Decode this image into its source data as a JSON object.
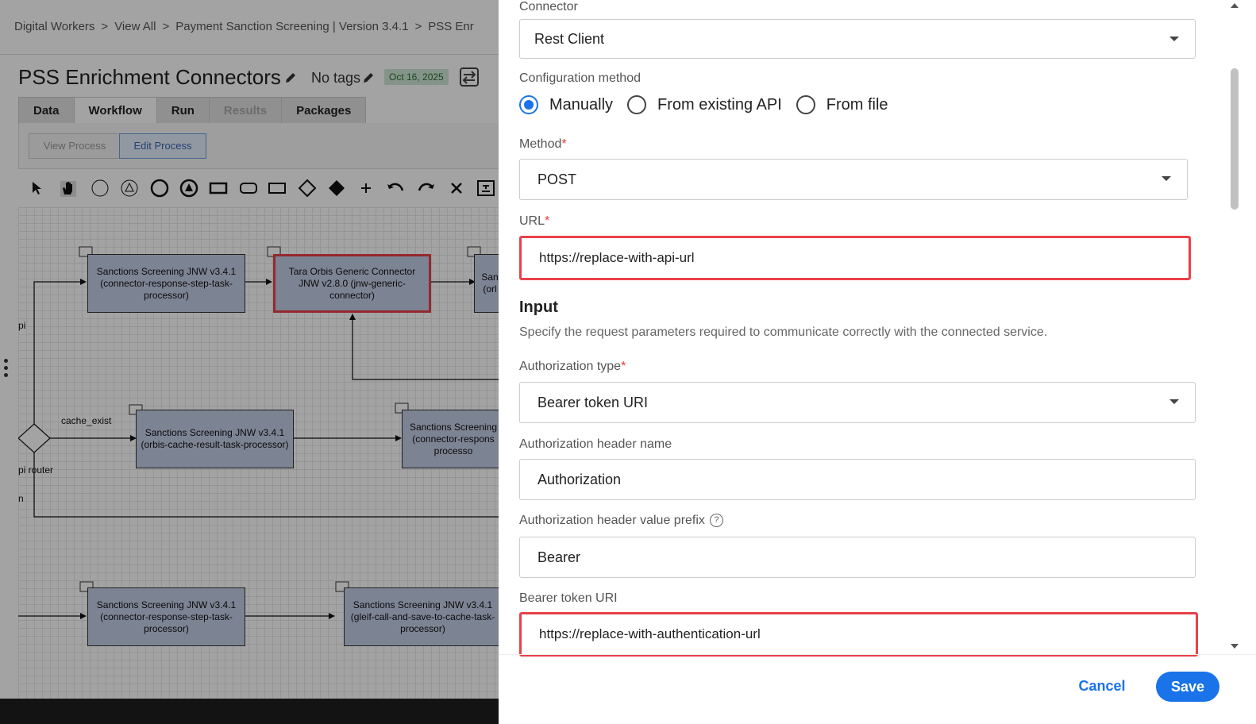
{
  "breadcrumb": [
    "Digital Workers",
    "View All",
    "Payment Sanction Screening | Version 3.4.1",
    "PSS Enr"
  ],
  "page_title": "PSS Enrichment Connectors",
  "tags_label": "No tags",
  "date_badge": "Oct 16, 2025",
  "tabs": [
    "Data",
    "Workflow",
    "Run",
    "Results",
    "Packages"
  ],
  "process_buttons": {
    "view": "View Process",
    "edit": "Edit Process"
  },
  "canvas": {
    "nodes": [
      "Sanctions Screening JNW v3.4.1 (connector-response-step-task-processor)",
      "Tara Orbis Generic Connector JNW v2.8.0 (jnw-generic-connector)",
      "San (orl",
      "Sanctions Screening JNW v3.4.1 (orbis-cache-result-task-processor)",
      "Sanctions Screening (connector-respons processo",
      "Sanctions Screening JNW v3.4.1 (connector-response-step-task-processor)",
      "Sanctions Screening JNW v3.4.1 (gleif-call-and-save-to-cache-task-processor)"
    ],
    "labels": {
      "cache_exist": "cache_exist",
      "pi": "pi",
      "pi_router": "pi router",
      "n": "n"
    }
  },
  "drawer": {
    "connector_label": "Connector",
    "connector_value": "Rest Client",
    "config_method_label": "Configuration method",
    "config_options": [
      "Manually",
      "From existing API",
      "From file"
    ],
    "config_selected": "Manually",
    "method_label": "Method",
    "method_value": "POST",
    "url_label": "URL",
    "url_value": "https://replace-with-api-url",
    "input_title": "Input",
    "input_desc": "Specify the request parameters required to communicate correctly with the connected service.",
    "auth_type_label": "Authorization type",
    "auth_type_value": "Bearer token URI",
    "auth_header_name_label": "Authorization header name",
    "auth_header_name_value": "Authorization",
    "auth_prefix_label": "Authorization header value prefix",
    "auth_prefix_value": "Bearer",
    "bearer_uri_label": "Bearer token URI",
    "bearer_uri_value": "https://replace-with-authentication-url",
    "cancel": "Cancel",
    "save": "Save"
  },
  "colors": {
    "accent": "#1a73e8",
    "highlight": "#e8414a",
    "node_fill": "#c3cde6",
    "required": "#e53935"
  }
}
